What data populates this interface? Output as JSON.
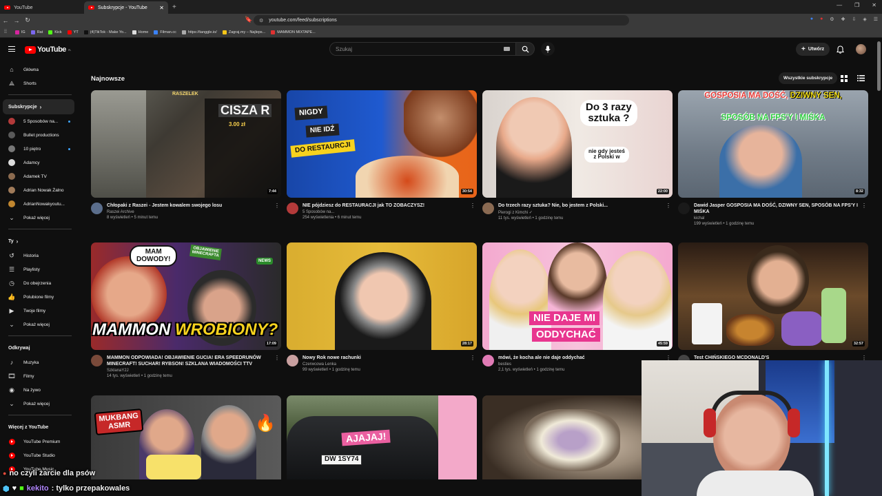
{
  "browser": {
    "tabs": [
      {
        "label": "YouTube",
        "active": false
      },
      {
        "label": "Subskrypcje - YouTube",
        "active": true
      }
    ],
    "url": "youtube.com/feed/subscriptions",
    "bookmarks": [
      {
        "label": "IG",
        "color": "#d6249f"
      },
      {
        "label": "Rat",
        "color": "#7b68ee"
      },
      {
        "label": "Kick",
        "color": "#53fc18"
      },
      {
        "label": "YT",
        "color": "#ff0000"
      },
      {
        "label": "(4)TikTok - Make Yo...",
        "color": "#111111"
      },
      {
        "label": "Home",
        "color": "#dddddd"
      },
      {
        "label": "Filman.cc",
        "color": "#3b82f6"
      },
      {
        "label": "https://tanggle.io/",
        "color": "#aaaaaa"
      },
      {
        "label": "Zagraj.my – Najleps...",
        "color": "#f5c518"
      },
      {
        "label": "MAMMON MIXTAPE...",
        "color": "#e03131"
      }
    ]
  },
  "header": {
    "logo_text": "YouTube",
    "logo_region": "PL",
    "search_placeholder": "Szukaj",
    "create_label": "Utwórz"
  },
  "sidebar": {
    "main": [
      {
        "label": "Główna",
        "icon": "home-icon"
      },
      {
        "label": "Shorts",
        "icon": "shorts-icon"
      }
    ],
    "subs_heading": "Subskrypcje",
    "subs": [
      {
        "label": "5 Sposobów na...",
        "color": "#b33a3a",
        "dot": true
      },
      {
        "label": "Bullet productions",
        "color": "#5a5a5a",
        "dot": false
      },
      {
        "label": "10 piętro",
        "color": "#777777",
        "dot": true
      },
      {
        "label": "Adamcy",
        "color": "#dddddd",
        "dot": false
      },
      {
        "label": "Adamek TV",
        "color": "#8c6b4f",
        "dot": false
      },
      {
        "label": "Adrian Nowak Żalno",
        "color": "#a07b5a",
        "dot": false
      },
      {
        "label": "AdrianNowakyoutu...",
        "color": "#c0862f",
        "dot": false
      }
    ],
    "subs_more": "Pokaż więcej",
    "you_heading": "Ty",
    "you": [
      {
        "label": "Historia",
        "icon": "history-icon"
      },
      {
        "label": "Playlisty",
        "icon": "playlist-icon"
      },
      {
        "label": "Do obejrzenia",
        "icon": "watch-later-icon"
      },
      {
        "label": "Polubione filmy",
        "icon": "like-icon"
      },
      {
        "label": "Twoje filmy",
        "icon": "your-videos-icon"
      },
      {
        "label": "Pokaż więcej",
        "icon": "chevron-down-icon"
      }
    ],
    "explore_heading": "Odkrywaj",
    "explore": [
      {
        "label": "Muzyka",
        "icon": "music-icon"
      },
      {
        "label": "Filmy",
        "icon": "film-icon"
      },
      {
        "label": "Na żywo",
        "icon": "live-icon"
      },
      {
        "label": "Pokaż więcej",
        "icon": "chevron-down-icon"
      }
    ],
    "more_heading": "Więcej z YouTube",
    "more": [
      {
        "label": "YouTube Premium"
      },
      {
        "label": "YouTube Studio"
      },
      {
        "label": "YouTube Music"
      }
    ]
  },
  "feed": {
    "section_title": "Najnowsze",
    "all_subs_label": "Wszystkie subskrypcje",
    "videos": [
      {
        "title": "Chłopaki z Raszei - Jestem kowalem swojego losu",
        "channel": "Raszei Archive",
        "stats": "8 wyświetleń • 5 minut temu",
        "duration": "7:44",
        "avatar": "#5b6e8c"
      },
      {
        "title": "NIE pójdziesz do RESTAURACJI jak TO ZOBACZYSZ!",
        "channel": "5 Sposobów na...",
        "stats": "254 wyświetlenia • 6 minut temu",
        "duration": "30:54",
        "avatar": "#b33a3a"
      },
      {
        "title": "Do trzech razy sztuka? Nie, bo jestem z Polski...",
        "channel": "Pierogi z Kimchi",
        "stats": "11 tys. wyświetleń • 1 godzinę temu",
        "duration": "22:00",
        "avatar": "#8a6a52"
      },
      {
        "title": "Dawid Jasper GOSPOSIA MA DOŚĆ, DZIWNY SEN, SPOSÓB NA FPS'Y I MIŚKA",
        "channel": "kichal",
        "stats": "199 wyświetleń • 1 godzinę temu",
        "duration": "8:32",
        "avatar": "#1a1a1a"
      },
      {
        "title": "MAMMON ODPOWIADA! OBJAWIENIE GUCIA! ERA SPEEDRUNÓW MINECRAFT! SUCHAR! RYBSON! SZKLANA WIADOMOŚCI TTV",
        "channel": "SzklanaY2J",
        "stats": "14 tys. wyświetleń • 1 godzinę temu",
        "duration": "17:09",
        "avatar": "#7a4a3a"
      },
      {
        "title": "Nowy Rok nowe rachunki",
        "channel": "Czerwcowa Lenka",
        "stats": "99 wyświetleń • 1 godzinę temu",
        "duration": "28:17",
        "avatar": "#c9a0a0"
      },
      {
        "title": "mówi, że kocha ale nie daje oddychać",
        "channel": "besties",
        "stats": "2,1 tys. wyświetleń • 1 godzinę temu",
        "duration": "45:59",
        "avatar": "#e07bb5"
      },
      {
        "title": "Test CHIŃSKIEGO MCDONALD'S",
        "channel": "",
        "stats": "",
        "duration": "32:57",
        "avatar": "#444444"
      }
    ],
    "thumb_text": {
      "v1_overlay": "RASZELEK",
      "v1_big": "CISZA R",
      "v1_donation": "3.00 zł",
      "v2_line1": "NIGDY",
      "v2_line2": "NIE IDŹ",
      "v2_line3": "DO RESTAURCJI",
      "v3_line1": "Do 3 razy",
      "v3_line2": "sztuka ?",
      "v3_line3": "nie gdy jesteś",
      "v3_line4": "z Polski w",
      "v4_line1a": "GOSPOSIA MA DOŚĆ,",
      "v4_line1b": "DZIWNY SEN,",
      "v4_line2": "SPOSÓB NA FPS'Y I MIŚKA",
      "v5_bubble1": "MAM",
      "v5_bubble2": "DOWODY!",
      "v5_tag1": "OBJAWIENIE",
      "v5_tag2": "MINECRAFTA",
      "v5_news": "NEWS",
      "v5_big1": "MAMMON",
      "v5_big2": "WROBIONY?",
      "v7_line1": "NIE DAJE MI",
      "v7_line2": "ODDYCHAĆ",
      "v9_line1": "MUKBANG",
      "v9_line2": "ASMR",
      "v10_text": "AJAJAJ!",
      "v10_plate": "DW 1SY74"
    }
  },
  "overlay": {
    "subtitle": "no czyli żarcie dla psów",
    "chat_user": "kekito",
    "chat_message": ": tylko przepakowales"
  },
  "colors": {
    "accent": "#ff0000",
    "background": "#0f0f0f"
  }
}
